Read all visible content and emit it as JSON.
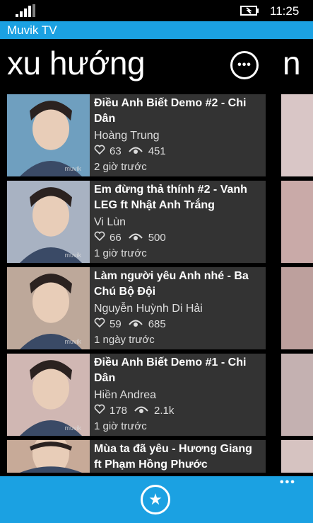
{
  "status": {
    "time": "11:25"
  },
  "app": {
    "title": "Muvik TV"
  },
  "pivot": {
    "current": "xu hướng",
    "next": "n"
  },
  "items": [
    {
      "title": "Điều Anh Biết Demo #2 - Chi Dân",
      "author": "Hoàng Trung",
      "likes": "63",
      "views": "451",
      "time": "2 giờ trước",
      "thumb_color": "#6f9fbf",
      "watermark": "muvik"
    },
    {
      "title": "Em đừng thả thính #2 - Vanh LEG ft Nhật Anh Trắng",
      "author": "Vi Lùn",
      "likes": "66",
      "views": "500",
      "time": "1 giờ trước",
      "thumb_color": "#a8b2c2",
      "watermark": "muvik"
    },
    {
      "title": "Làm người yêu Anh nhé - Ba Chú Bộ Đội",
      "author": "Nguyễn Huỳnh Di Hải",
      "likes": "59",
      "views": "685",
      "time": "1 ngày trước",
      "thumb_color": "#bda89a",
      "watermark": "muvik"
    },
    {
      "title": "Điều Anh Biết Demo #1 - Chi Dân",
      "author": "Hiền Andrea",
      "likes": "178",
      "views": "2.1k",
      "time": "1 giờ trước",
      "thumb_color": "#d0b7b3",
      "watermark": "muvik"
    },
    {
      "title": "Mùa ta đã yêu - Hương Giang ft Phạm Hồng Phước",
      "author": "",
      "likes": "",
      "views": "",
      "time": "",
      "thumb_color": "#c7aa98",
      "watermark": ""
    }
  ],
  "appbar": {
    "favorite_icon": "★",
    "more": "•••"
  },
  "colors": {
    "accent": "#1ba1e2",
    "card": "#333333"
  }
}
